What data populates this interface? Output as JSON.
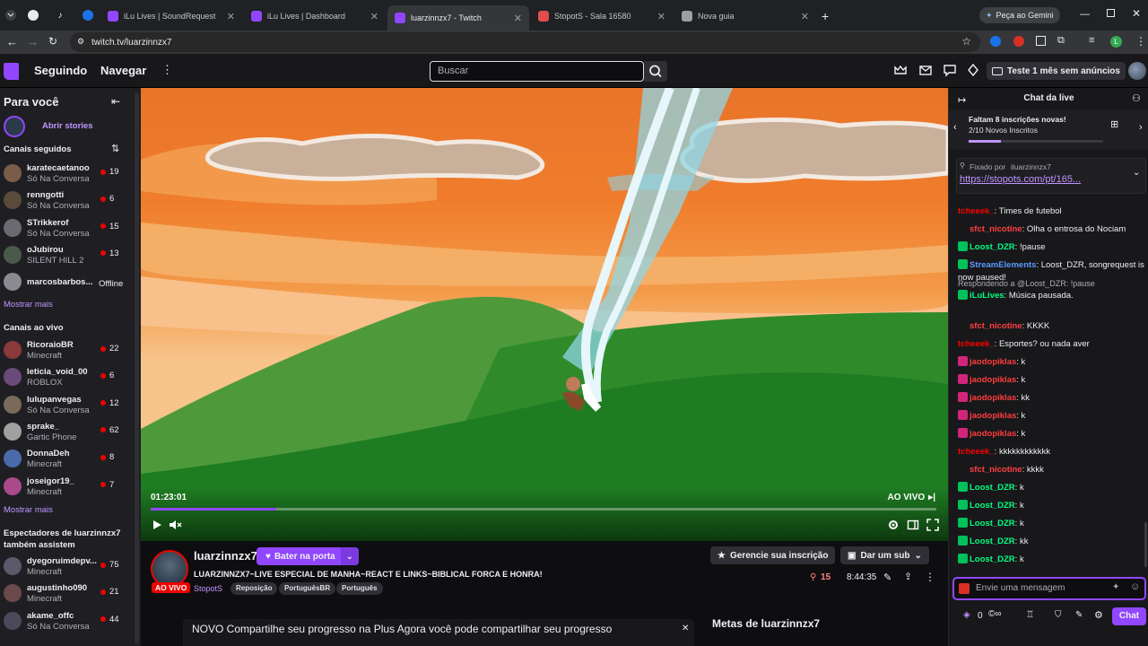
{
  "browser": {
    "tabs": [
      {
        "label": "iLu Lives | SoundRequest",
        "color": "#9147ff"
      },
      {
        "label": "iLu Lives | Dashboard",
        "color": "#9147ff"
      },
      {
        "label": "luarzinnzx7 - Twitch",
        "color": "#9147ff"
      },
      {
        "label": "StopotS - Sala 16580",
        "color": "#e04e4e"
      },
      {
        "label": "Nova guia",
        "color": "#9aa0a6"
      }
    ],
    "gemini": "Peça ao Gemini",
    "url": "twitch.tv/luarzinnzx7"
  },
  "topnav": {
    "following": "Seguindo",
    "browse": "Navegar",
    "search_placeholder": "Buscar",
    "trial": "Teste 1 mês sem anúncios"
  },
  "sidebar": {
    "for_you": "Para você",
    "open_stories": "Abrir stories",
    "followed_header": "Canais seguidos",
    "followed": [
      {
        "name": "karatecaetanoo",
        "game": "Só Na Conversa",
        "viewers": "19",
        "color": "#7a5c48"
      },
      {
        "name": "renngotti",
        "game": "Só Na Conversa",
        "viewers": "6",
        "color": "#5a4a3a"
      },
      {
        "name": "STrikkerof",
        "game": "Só Na Conversa",
        "viewers": "15",
        "color": "#6a6a70"
      },
      {
        "name": "oJubirou",
        "game": "SILENT HILL 2",
        "viewers": "13",
        "color": "#4a5a4a"
      },
      {
        "name": "marcosbarbos...",
        "game": "",
        "viewers": "Offline",
        "color": "#8a8a90"
      }
    ],
    "show_more_1": "Mostrar mais",
    "live_header": "Canais ao vivo",
    "live": [
      {
        "name": "RicoraioBR",
        "game": "Minecraft",
        "viewers": "22",
        "color": "#8a3a3a"
      },
      {
        "name": "leticia_void_00",
        "game": "ROBLOX",
        "viewers": "6",
        "color": "#6a4a7a"
      },
      {
        "name": "lulupanvegas",
        "game": "Só Na Conversa",
        "viewers": "12",
        "color": "#7a6a5a"
      },
      {
        "name": "sprake_",
        "game": "Gartic Phone",
        "viewers": "62",
        "color": "#a0a0a0"
      },
      {
        "name": "DonnaDeh",
        "game": "Minecraft",
        "viewers": "8",
        "color": "#4a6aaa"
      },
      {
        "name": "joseigor19_",
        "game": "Minecraft",
        "viewers": "7",
        "color": "#aa4a8a"
      }
    ],
    "show_more_2": "Mostrar mais",
    "also_header": "Espectadores de luarzinnzx7 também assistem",
    "also": [
      {
        "name": "dyegoruimdepv...",
        "game": "Minecraft",
        "viewers": "75",
        "color": "#5a5a6a"
      },
      {
        "name": "augustinho090",
        "game": "Minecraft",
        "viewers": "21",
        "color": "#6a4a4a"
      },
      {
        "name": "akame_offc",
        "game": "Só Na Conversa",
        "viewers": "44",
        "color": "#4a4a5a"
      }
    ]
  },
  "player": {
    "time": "01:23:01",
    "live_label": "AO VIVO",
    "progress": 0.16
  },
  "stream": {
    "name": "luarzinnzx7",
    "follow": "Bater na porta",
    "title": "LUARZINNZX7~LIVE ESPECIAL DE MANHA~REACT E LINKS~BIBLICAL FORCA E HONRA!",
    "category": "StopotS",
    "tags": [
      "Reposição",
      "PortuguêsBR",
      "Português"
    ],
    "live_badge": "AO VIVO",
    "manage_sub": "Gerencie sua inscrição",
    "gift_sub": "Dar um sub",
    "viewers": "15",
    "uptime": "8:44:35",
    "banner_text": "NOVO Compartilhe seu progresso na Plus Agora você pode compartilhar seu progresso",
    "goals": "Metas de luarzinnzx7"
  },
  "chat": {
    "header": "Chat da live",
    "hype_title": "Faltam 8 inscrições novas!",
    "hype_sub": "2/10 Novos Inscritos",
    "pinned_by": "Fixado por",
    "pinned_user": "iluarzinnzx7",
    "pinned_link": "https://stopots.com/pt/165...",
    "messages": [
      {
        "user": "tcheeek_",
        "text": "Times de futebol",
        "color": "#ff0000"
      },
      {
        "user": "sfct_nicotine",
        "text": "Olha o entrosa do Nociam",
        "color": "#ff4040"
      },
      {
        "user": "Loost_DZR",
        "text": "!pause",
        "color": "#00ff7f"
      },
      {
        "user": "StreamElements",
        "text": "Loost_DZR, songrequest is now paused!",
        "color": "#5b99ff"
      },
      {
        "user": "iLuLives",
        "text": "Música pausada.",
        "color": "#00ff7f",
        "reply": "Respondendo a @Loost_DZR: !pause"
      },
      {
        "user": "sfct_nicotine",
        "text": "KKKK",
        "color": "#ff4040"
      },
      {
        "user": "tcheeek_",
        "text": "Esportes? ou nada aver",
        "color": "#ff0000"
      },
      {
        "user": "jaodopiklas",
        "text": "k",
        "color": "#ff3c3c"
      },
      {
        "user": "jaodopiklas",
        "text": "k",
        "color": "#ff3c3c"
      },
      {
        "user": "jaodopiklas",
        "text": "kk",
        "color": "#ff3c3c"
      },
      {
        "user": "jaodopiklas",
        "text": "k",
        "color": "#ff3c3c"
      },
      {
        "user": "jaodopiklas",
        "text": "k",
        "color": "#ff3c3c"
      },
      {
        "user": "tcheeek_",
        "text": "kkkkkkkkkkkk",
        "color": "#ff0000"
      },
      {
        "user": "sfct_nicotine",
        "text": "kkkk",
        "color": "#ff4040"
      },
      {
        "user": "Loost_DZR",
        "text": "k",
        "color": "#00ff7f"
      },
      {
        "user": "Loost_DZR",
        "text": "k",
        "color": "#00ff7f"
      },
      {
        "user": "Loost_DZR",
        "text": "k",
        "color": "#00ff7f"
      },
      {
        "user": "Loost_DZR",
        "text": "kk",
        "color": "#00ff7f"
      },
      {
        "user": "Loost_DZR",
        "text": "k",
        "color": "#00ff7f"
      }
    ],
    "input_placeholder": "Envie uma mensagem",
    "points": "0",
    "chat_button": "Chat"
  }
}
